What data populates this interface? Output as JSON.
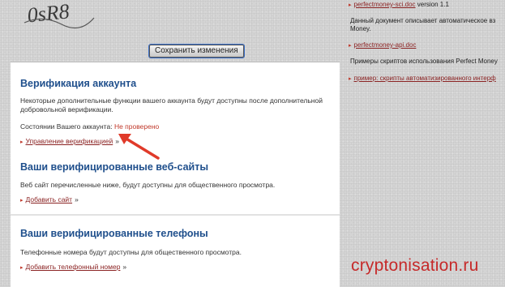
{
  "captcha": {
    "text": "0sR8"
  },
  "save_button": {
    "label": "Сохранить изменения"
  },
  "verification": {
    "title": "Верификация аккаунта",
    "description": "Некоторые дополнительные функции вашего аккаунта будут доступны после дополнительной добровольной верификации.",
    "status_label": "Состоянии Вашего аккаунта:",
    "status_value": "Не проверено",
    "manage_link": "Управление верификацией",
    "raquo": "»"
  },
  "websites": {
    "title": "Ваши верифицированные веб-сайты",
    "description": "Веб сайт перечисленные ниже, будут доступны для общественного просмотра.",
    "add_link": "Добавить сайт",
    "raquo": "»"
  },
  "phones": {
    "title": "Ваши верифицированные телефоны",
    "description": "Телефонные номера будут доступны для общественного просмотра.",
    "add_link": "Добавить телефонный номер",
    "raquo": "»"
  },
  "right_column": {
    "link1": "perfectmoney-sci.doc",
    "link1_suffix": " version 1.1",
    "text1_line1": "Данный документ описывает автоматическое вз",
    "text1_line2": "Money.",
    "link2": "perfectmoney-api.doc",
    "text2": "Примеры скриптов использования Perfect Money",
    "link3": "пример: скрипты автоматизированного интерф"
  },
  "watermark": "cryptonisation.ru",
  "colors": {
    "accent_title": "#1f4f8c",
    "status_red": "#c0392b",
    "link": "#8b2323",
    "watermark": "#c62a2a"
  }
}
